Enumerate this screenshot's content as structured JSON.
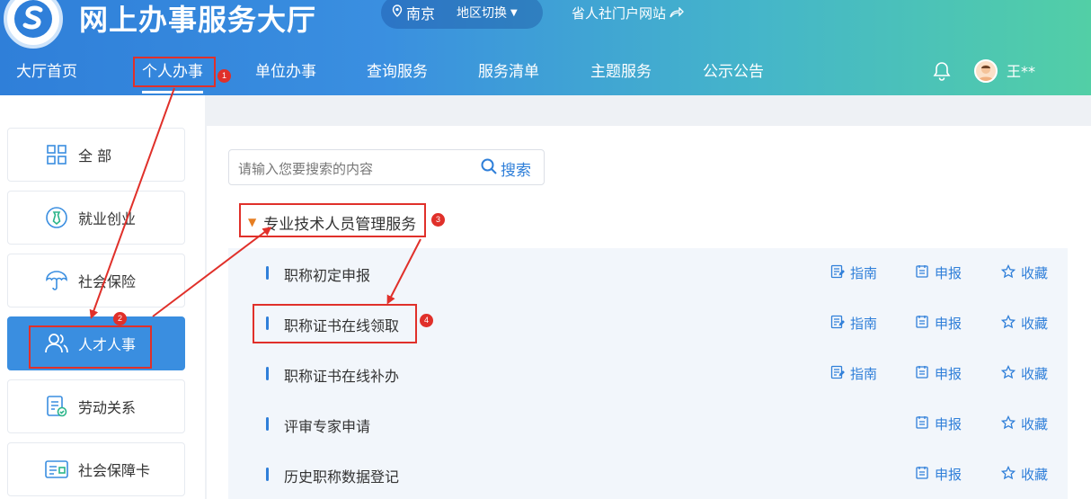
{
  "header": {
    "site_title": "网上办事服务大厅",
    "region_city": "南京",
    "region_switch": "地区切换",
    "portal_link": "省人社门户网站",
    "username": "王**"
  },
  "nav": {
    "items": [
      {
        "label": "大厅首页"
      },
      {
        "label": "个人办事"
      },
      {
        "label": "单位办事"
      },
      {
        "label": "查询服务"
      },
      {
        "label": "服务清单"
      },
      {
        "label": "主题服务"
      },
      {
        "label": "公示公告"
      }
    ]
  },
  "sidebar": {
    "items": [
      {
        "label": "全 部",
        "icon": "grid-icon"
      },
      {
        "label": "就业创业",
        "icon": "tie-icon"
      },
      {
        "label": "社会保险",
        "icon": "umbrella-icon"
      },
      {
        "label": "人才人事",
        "icon": "people-icon"
      },
      {
        "label": "劳动关系",
        "icon": "document-icon"
      },
      {
        "label": "社会保障卡",
        "icon": "card-icon"
      }
    ]
  },
  "search": {
    "placeholder": "请输入您要搜索的内容",
    "button": "搜索"
  },
  "group": {
    "title": "专业技术人员管理服务"
  },
  "services": [
    {
      "name": "职称初定申报",
      "guide": "指南",
      "apply": "申报",
      "favorite": "收藏"
    },
    {
      "name": "职称证书在线领取",
      "guide": "指南",
      "apply": "申报",
      "favorite": "收藏"
    },
    {
      "name": "职称证书在线补办",
      "guide": "指南",
      "apply": "申报",
      "favorite": "收藏"
    },
    {
      "name": "评审专家申请",
      "apply": "申报",
      "favorite": "收藏"
    },
    {
      "name": "历史职称数据登记",
      "apply": "申报",
      "favorite": "收藏"
    }
  ],
  "annotations": {
    "step1": "1",
    "step2": "2",
    "step3": "3",
    "step4": "4"
  },
  "colors": {
    "primary": "#2f7fd9",
    "header_gradient_end": "#52cfa6",
    "highlight_red": "#e0302a",
    "active_side": "#3a8ee0"
  }
}
